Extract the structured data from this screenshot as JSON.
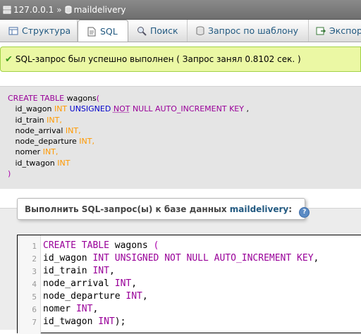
{
  "breadcrumb": {
    "server": "127.0.0.1",
    "separator": "»",
    "database": "maildelivery"
  },
  "tabs": [
    {
      "label": "Структура",
      "icon": "structure-icon"
    },
    {
      "label": "SQL",
      "icon": "sql-icon",
      "active": true
    },
    {
      "label": "Поиск",
      "icon": "search-icon"
    },
    {
      "label": "Запрос по шаблону",
      "icon": "query-icon"
    },
    {
      "label": "Экспорт",
      "icon": "export-icon"
    }
  ],
  "notice": {
    "text": "SQL-запрос был успешно выполнен ( Запрос занял 0.8102 сек. )"
  },
  "executed_sql": {
    "l1_kw": "CREATE TABLE",
    "l1_name": " wagons",
    "l1_paren": "(",
    "l2_col": "   id_wagon ",
    "l2_type": "INT",
    "l2_kw1": " UNSIGNED ",
    "l2_kw2": "NOT",
    "l2_kw3": " NULL AUTO_INCREMENT KEY",
    "l2_comma": " ,",
    "l3_col": "   id_train ",
    "l3_type": "INT,",
    "l4_col": "   node_arrival ",
    "l4_type": "INT,",
    "l5_col": "   node_departure ",
    "l5_type": "INT,",
    "l6_col": "   nomer ",
    "l6_type": "INT,",
    "l7_col": "   id_twagon ",
    "l7_type": "INT",
    "l8_paren": ")"
  },
  "query_panel": {
    "legend_prefix": "Выполнить SQL-запрос(ы) к базе данных",
    "database": "maildelivery",
    "legend_suffix": ":",
    "help_icon": "?"
  },
  "editor": {
    "line_numbers": [
      "1",
      "2",
      "3",
      "4",
      "5",
      "6",
      "7"
    ],
    "lines": [
      {
        "kw": "CREATE TABLE",
        "rest": " wagons ",
        "paren": "("
      },
      {
        "col": "id_wagon ",
        "kw": "INT UNSIGNED NOT NULL AUTO_INCREMENT KEY",
        "rest": ","
      },
      {
        "col": "id_train ",
        "kw": "INT",
        "rest": ","
      },
      {
        "col": "node_arrival ",
        "kw": "INT",
        "rest": ","
      },
      {
        "col": "node_departure ",
        "kw": "INT",
        "rest": ","
      },
      {
        "col": "nomer ",
        "kw": "INT",
        "rest": ","
      },
      {
        "col": "id_twagon ",
        "kw": "INT",
        "rest": ");"
      }
    ]
  }
}
